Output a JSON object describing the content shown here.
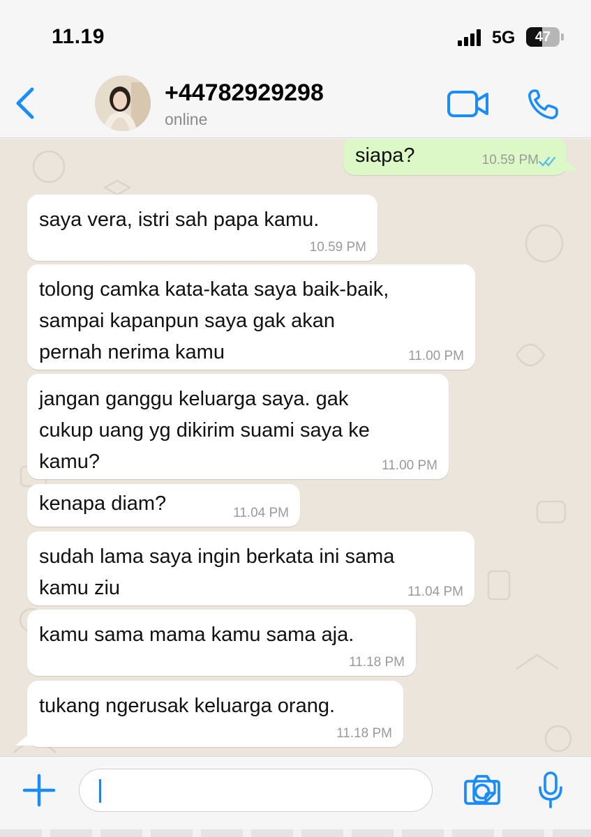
{
  "status_bar": {
    "time": "11.19",
    "network": "5G",
    "battery": "47",
    "battery_level": 0.47
  },
  "header": {
    "contact_name": "+44782929298",
    "contact_status": "online",
    "icons": {
      "back": "chevron-left-icon",
      "video": "video-camera-icon",
      "call": "phone-icon"
    }
  },
  "messages": [
    {
      "direction": "outgoing",
      "text": "siapa?",
      "time": "10.59 PM",
      "read": true
    },
    {
      "direction": "incoming",
      "text": "saya vera, istri sah papa kamu.",
      "time": "10.59 PM"
    },
    {
      "direction": "incoming",
      "lines": [
        "tolong camka kata-kata saya baik-baik,",
        "sampai kapanpun saya gak akan",
        "pernah nerima kamu"
      ],
      "time": "11.00 PM"
    },
    {
      "direction": "incoming",
      "lines": [
        "jangan ganggu keluarga saya. gak",
        "cukup uang yg dikirim suami saya ke",
        "kamu?"
      ],
      "time": "11.00 PM"
    },
    {
      "direction": "incoming",
      "text": "kenapa diam?",
      "time": "11.04 PM"
    },
    {
      "direction": "incoming",
      "lines": [
        "sudah lama saya ingin berkata ini sama",
        "kamu ziu"
      ],
      "time": "11.04 PM"
    },
    {
      "direction": "incoming",
      "text": "kamu sama mama kamu sama aja.",
      "time": "11.18 PM"
    },
    {
      "direction": "incoming",
      "text": "tukang ngerusak keluarga orang.",
      "time": "11.18 PM"
    }
  ],
  "composer": {
    "icons": {
      "plus": "plus-icon",
      "sticker": "sticker-icon",
      "camera": "camera-icon",
      "mic": "microphone-icon"
    }
  },
  "colors": {
    "accent": "#1a8cff",
    "outgoing_bubble": "#dcf8c6",
    "incoming_bubble": "#ffffff",
    "chat_background": "#ece5dc",
    "read_ticks": "#53bdeb"
  }
}
